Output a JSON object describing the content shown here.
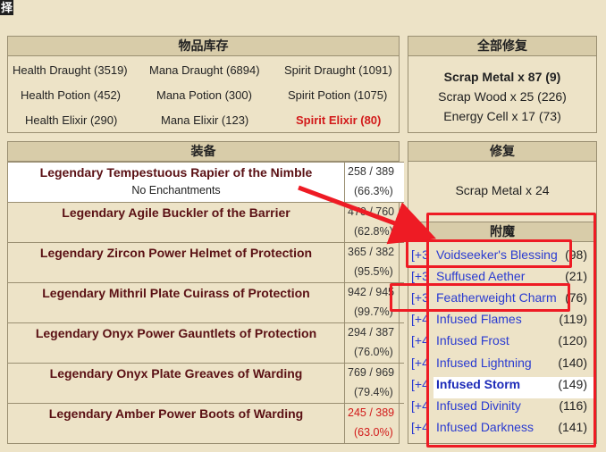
{
  "corner_char": "择",
  "inventory": {
    "title": "物品库存",
    "rows": [
      [
        "Health Draught (3519)",
        "Mana Draught (6894)",
        "Spirit Draught (1091)"
      ],
      [
        "Health Potion (452)",
        "Mana Potion (300)",
        "Spirit Potion (1075)"
      ],
      [
        "Health Elixir (290)",
        "Mana Elixir (123)",
        "Spirit Elixir (80)"
      ]
    ]
  },
  "repair_all": {
    "title": "全部修复",
    "items": [
      "Scrap Metal x 87 (9)",
      "Scrap Wood x 25 (226)",
      "Energy Cell x 17 (73)"
    ]
  },
  "equipment": {
    "title": "装备",
    "items": [
      {
        "name": "Legendary Tempestuous Rapier of the Nimble",
        "sub": "No Enchantments",
        "durability": "258 / 389",
        "percent": "(66.3%)"
      },
      {
        "name": "Legendary Agile Buckler of the Barrier",
        "durability": "470 / 760",
        "percent": "(62.8%)"
      },
      {
        "name": "Legendary Zircon Power Helmet of Protection",
        "durability": "365 / 382",
        "percent": "(95.5%)"
      },
      {
        "name": "Legendary Mithril Plate Cuirass of Protection",
        "durability": "942 / 945",
        "percent": "(99.7%)"
      },
      {
        "name": "Legendary Onyx Power Gauntlets of Protection",
        "durability": "294 / 387",
        "percent": "(76.0%)"
      },
      {
        "name": "Legendary Onyx Plate Greaves of Warding",
        "durability": "769 / 969",
        "percent": "(79.4%)"
      },
      {
        "name": "Legendary Amber Power Boots of Warding",
        "durability": "245 / 389",
        "percent": "(63.0%)"
      }
    ]
  },
  "repair": {
    "title": "修复",
    "item": "Scrap Metal x 24"
  },
  "enchant": {
    "title": "附魔",
    "items": [
      {
        "prefix": "[+3",
        "name": "Voidseeker's Blessing",
        "count": "(98)"
      },
      {
        "prefix": "[+3",
        "name": "Suffused Aether",
        "count": "(21)"
      },
      {
        "prefix": "[+3",
        "name": "Featherweight Charm",
        "count": "(76)"
      },
      {
        "prefix": "[+4",
        "name": "Infused Flames",
        "count": "(119)"
      },
      {
        "prefix": "[+4",
        "name": "Infused Frost",
        "count": "(120)"
      },
      {
        "prefix": "[+4",
        "name": "Infused Lightning",
        "count": "(140)"
      },
      {
        "prefix": "[+4",
        "name": "Infused Storm",
        "count": "(149)"
      },
      {
        "prefix": "[+4",
        "name": "Infused Divinity",
        "count": "(116)"
      },
      {
        "prefix": "[+4",
        "name": "Infused Darkness",
        "count": "(141)"
      }
    ]
  },
  "colors": {
    "accent_red": "#d21a1a",
    "link_blue": "#2a3bd1",
    "item_name": "#5a1014",
    "annotation": "#ee1b24"
  }
}
